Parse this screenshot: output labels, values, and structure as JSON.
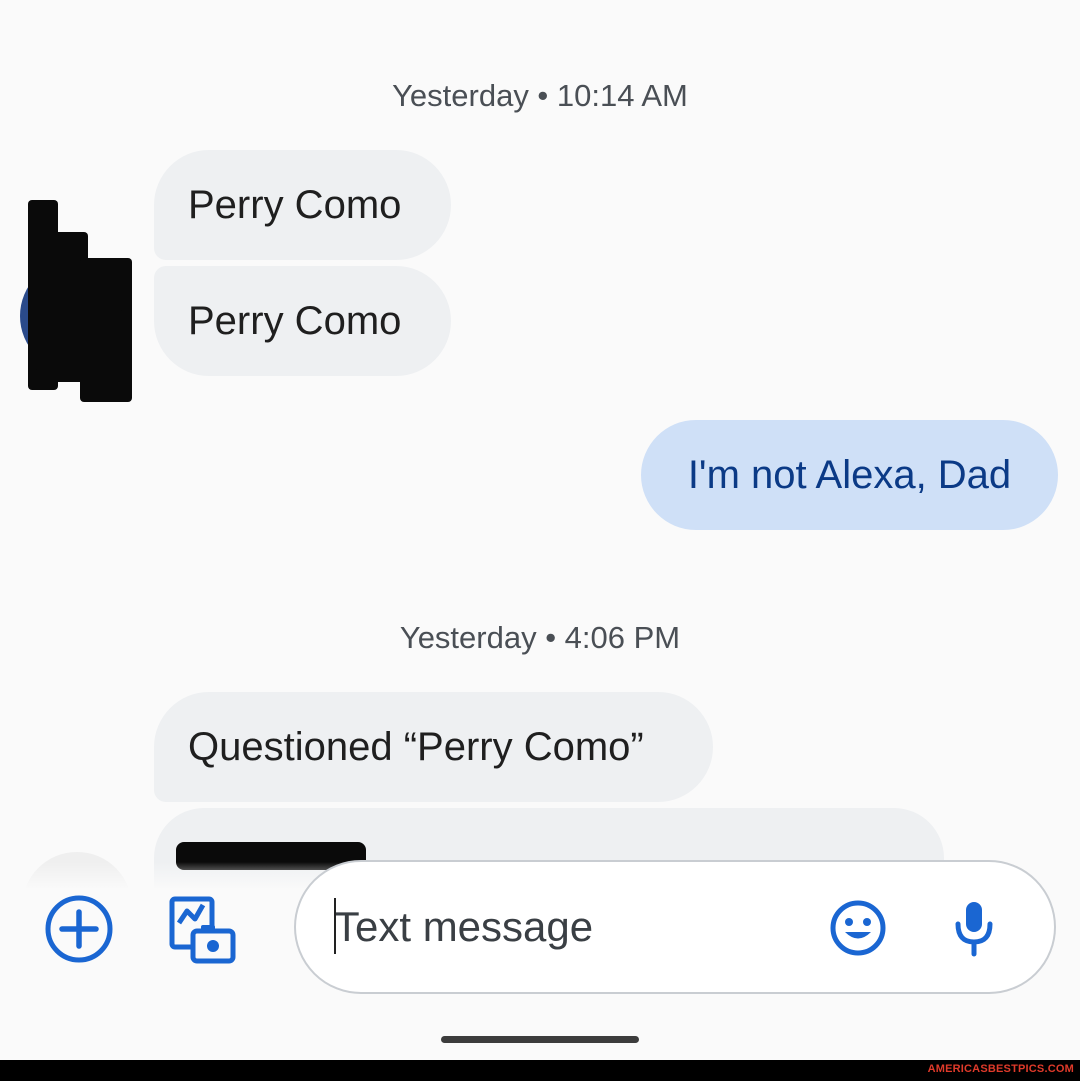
{
  "messages": {
    "timestamp_1": "Yesterday • 10:14 AM",
    "incoming_1": "Perry Como",
    "incoming_2": "Perry Como",
    "outgoing_1": "I'm not Alexa, Dad",
    "timestamp_2": "Yesterday • 4:06 PM",
    "incoming_3": "Questioned “Perry Como”"
  },
  "compose": {
    "placeholder": "Text message",
    "value": ""
  },
  "icons": {
    "add": "add-circle-icon",
    "gallery": "gallery-camera-icon",
    "emoji": "emoji-icon",
    "mic": "mic-icon"
  },
  "colors": {
    "accent": "#1a66d2",
    "incoming_bubble": "#eef0f2",
    "outgoing_bubble": "#cfe0f7",
    "outgoing_text": "#0b3a86"
  },
  "footer": {
    "watermark": "AMERICASBESTPICS.COM"
  }
}
